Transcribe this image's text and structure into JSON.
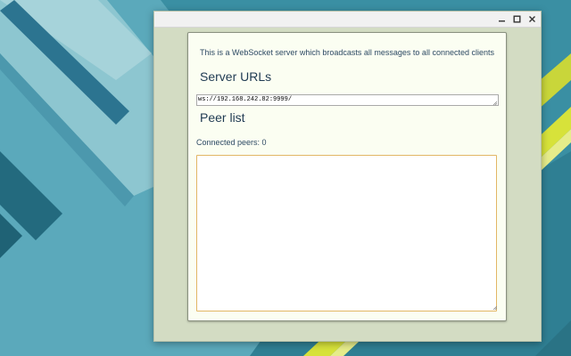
{
  "window": {
    "controls": {
      "minimize_icon": "minimize-icon",
      "maximize_icon": "maximize-icon",
      "close_icon": "close-icon"
    }
  },
  "app": {
    "intro_text": "This is a WebSocket server which broadcasts all messages to all connected clients",
    "server_urls_heading": "Server URLs",
    "server_url_value": "ws://192.168.242.82:9999/",
    "peer_list_heading": "Peer list",
    "connected_peers_text": "Connected peers: 0",
    "peer_list_value": ""
  },
  "colors": {
    "window_background": "#d3dcc3",
    "panel_background": "#fbfef2",
    "heading_text": "#1f3a52",
    "body_text": "#2e4a64",
    "focus_border": "#e2b765",
    "desktop_teal": "#2f7f93",
    "accent_yellow": "#d7e23a"
  }
}
